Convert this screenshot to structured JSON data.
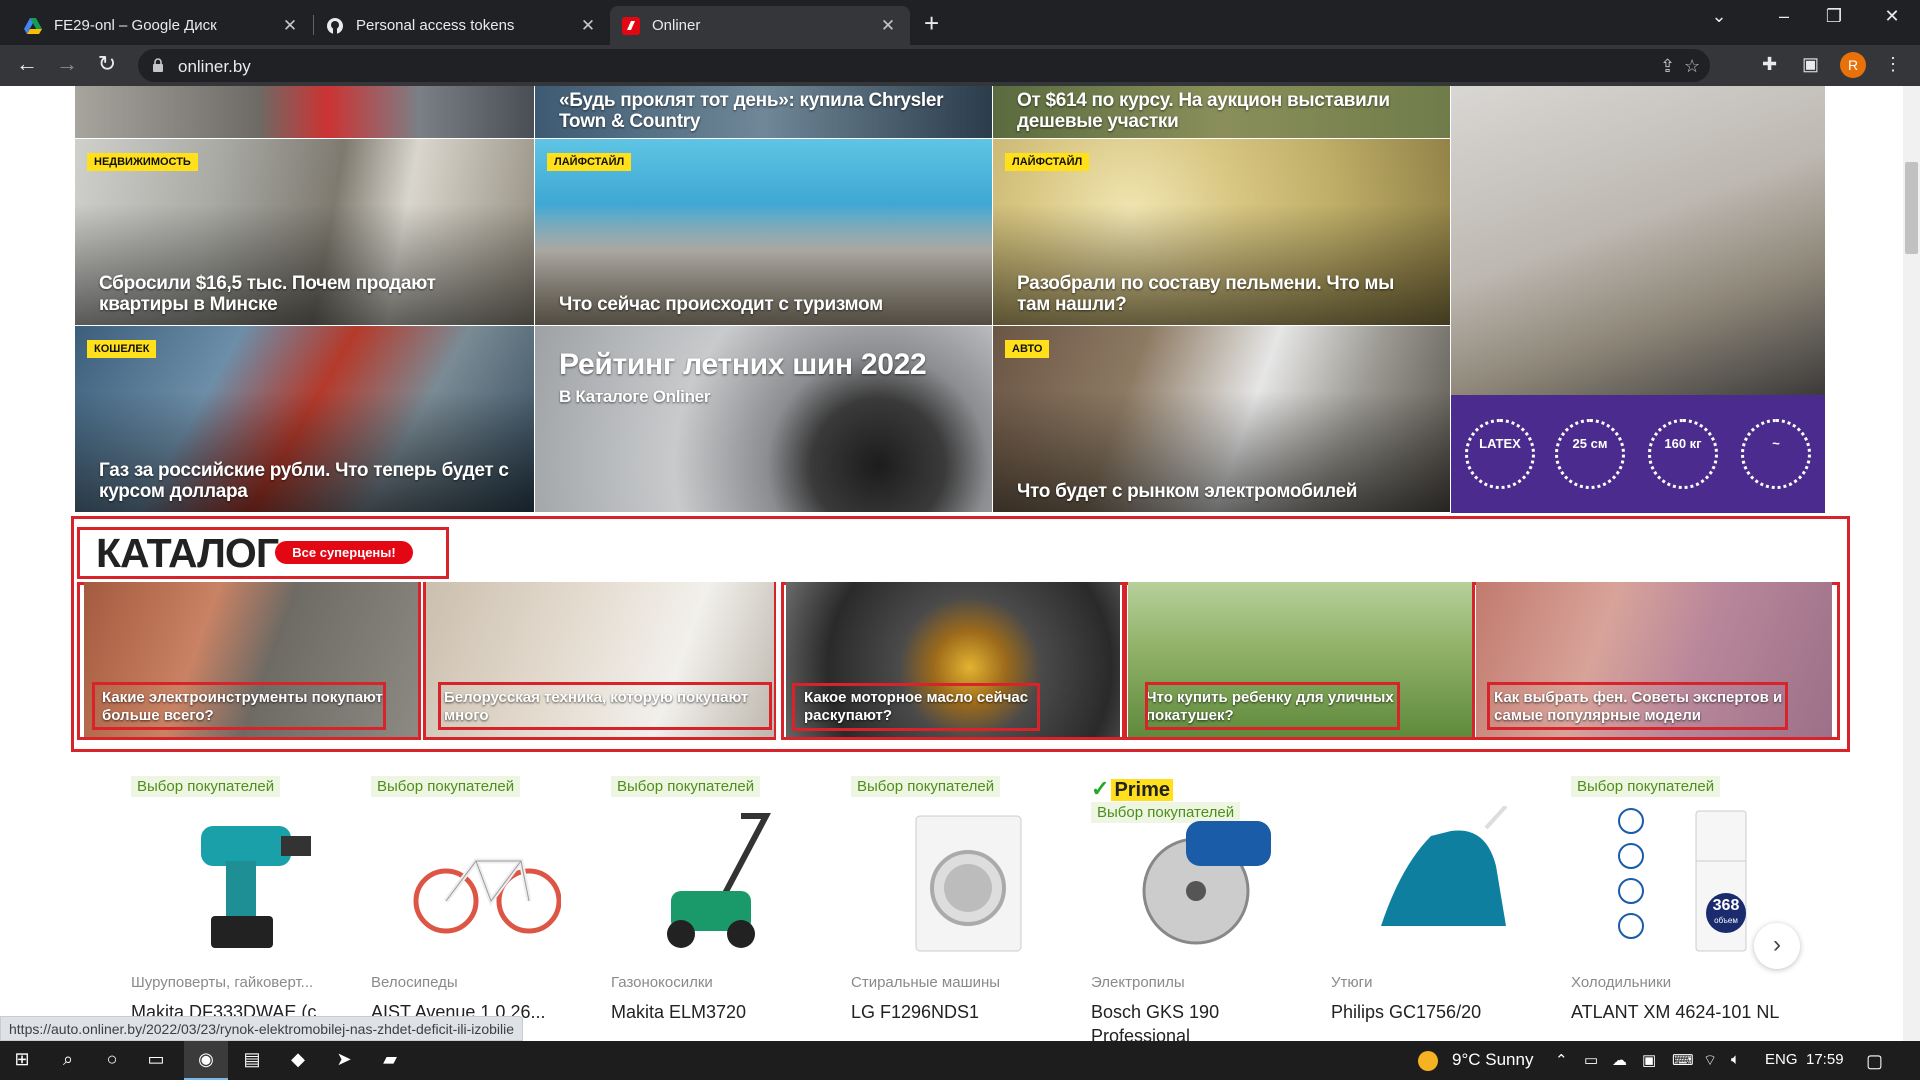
{
  "browser": {
    "tabs": [
      {
        "title": "FE29-onl – Google Диск",
        "icon": "google-drive-icon"
      },
      {
        "title": "Personal access tokens",
        "icon": "github-icon"
      },
      {
        "title": "Onliner",
        "icon": "onliner-icon"
      }
    ],
    "url": "onliner.by",
    "profile_initial": "R"
  },
  "news": {
    "top_row": [
      {
        "title": "«Будь проклят тот день»: купила Chrysler Town & Country"
      },
      {
        "title": "От $614 по курсу. На аукцион выставили дешевые участки"
      }
    ],
    "row2": [
      {
        "tag": "Недвижимость",
        "title": "Сбросили $16,5 тыс. Почем продают квартиры в Минске"
      },
      {
        "tag": "Лайфстайл",
        "title": "Что сейчас происходит с туризмом"
      },
      {
        "tag": "Лайфстайл",
        "title": "Разобрали по составу пельмени. Что мы там нашли?"
      }
    ],
    "row3": [
      {
        "tag": "Кошелек",
        "title": "Газ за российские рубли. Что теперь будет с курсом доллара"
      },
      {
        "title": "Рейтинг летних шин 2022",
        "subtitle": "В Каталоге Onliner"
      },
      {
        "tag": "Авто",
        "title": "Что будет с рынком электромобилей"
      }
    ]
  },
  "ad": {
    "badges": [
      "LATEX",
      "25 см",
      "160 кг",
      "~"
    ]
  },
  "catalog": {
    "title": "КАТАЛОГ",
    "sale_label": "Все суперцены!",
    "cards": [
      {
        "title": "Какие электроинструменты покупают больше всего?"
      },
      {
        "title": "Белорусская техника, которую покупают много"
      },
      {
        "title": "Какое моторное масло сейчас раскупают?"
      },
      {
        "title": "Что купить ребенку для уличных покатушек?"
      },
      {
        "title": "Как выбрать фен. Советы экспертов и самые популярные модели"
      }
    ]
  },
  "products": {
    "prime_label": "Prime",
    "items": [
      {
        "badge": "Выбор покупателей",
        "category": "Шуруповерты, гайковерт...",
        "name": "Makita DF333DWAE (с..."
      },
      {
        "badge": "Выбор покупателей",
        "category": "Велосипеды",
        "name": "AIST Avenue 1.0 26..."
      },
      {
        "badge": "Выбор покупателей",
        "category": "Газонокосилки",
        "name": "Makita ELM3720"
      },
      {
        "badge": "Выбор покупателей",
        "category": "Стиральные машины",
        "name": "LG F1296NDS1"
      },
      {
        "badge": "Выбор покупателей",
        "category": "Электропилы",
        "name": "Bosch GKS 190 Professional"
      },
      {
        "badge": "",
        "category": "Утюги",
        "name": "Philips GC1756/20"
      },
      {
        "badge": "Выбор покупателей",
        "category": "Холодильники",
        "name": "ATLANT ХМ 4624-101 NL"
      }
    ],
    "fridge_volume": "368",
    "fridge_volume_unit": "объем"
  },
  "status_url": "https://auto.onliner.by/2022/03/23/rynok-elektromobilej-nas-zhdet-deficit-ili-izobilie",
  "taskbar": {
    "weather_temp": "9°C",
    "weather_text": "Sunny",
    "lang": "ENG",
    "time": "17:59"
  }
}
